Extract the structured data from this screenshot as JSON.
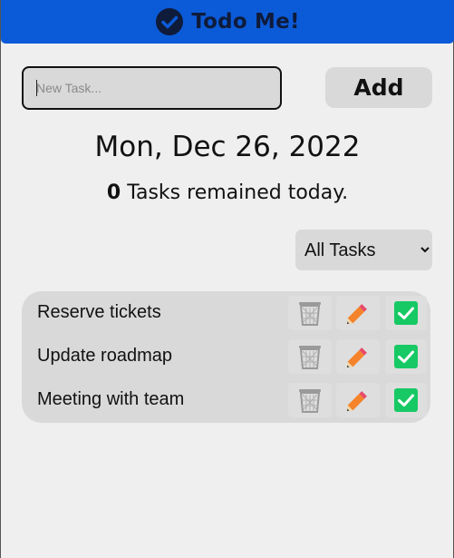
{
  "header": {
    "title": "Todo Me!",
    "logo_icon": "check-circle-icon"
  },
  "new_task": {
    "placeholder": "New Task...",
    "value": "",
    "add_label": "Add"
  },
  "date_text": "Mon, Dec 26, 2022",
  "summary": {
    "count": "0",
    "text": " Tasks remained today."
  },
  "filter": {
    "selected": "All Tasks"
  },
  "tasks": [
    {
      "label": "Reserve tickets",
      "done": true
    },
    {
      "label": "Update roadmap",
      "done": true
    },
    {
      "label": "Meeting with team",
      "done": true
    }
  ],
  "colors": {
    "header": "#0b5bd8",
    "check": "#17c964",
    "pencil": "#f4832b"
  }
}
